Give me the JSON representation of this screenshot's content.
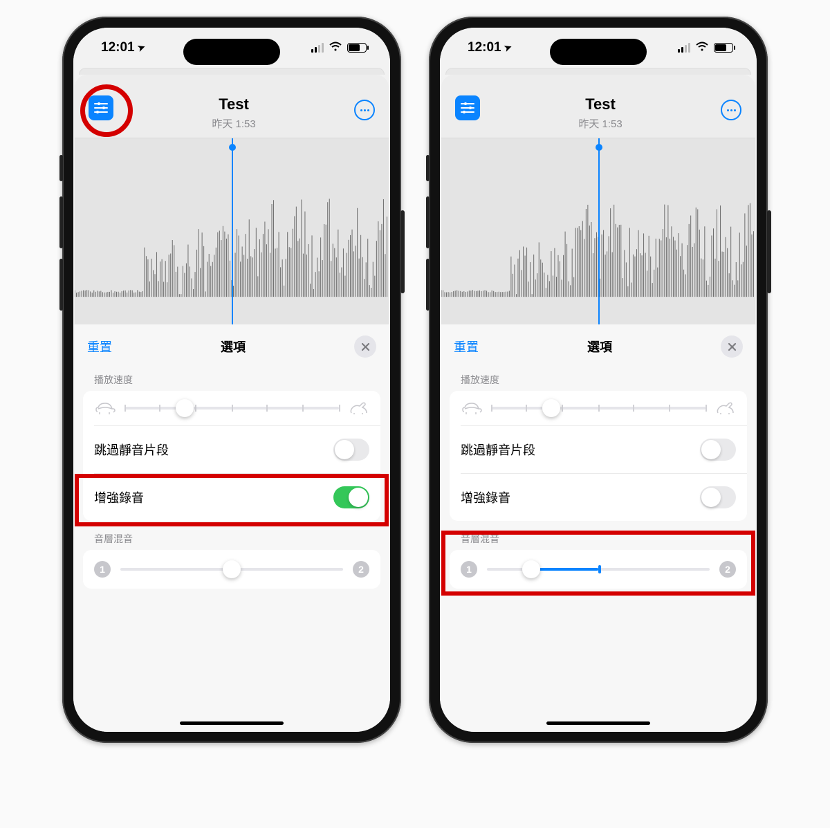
{
  "status": {
    "time": "12:01",
    "location_arrow": "➤"
  },
  "memo": {
    "title": "Test",
    "subtitle": "昨天  1:53"
  },
  "sheet": {
    "reset": "重置",
    "title": "選項",
    "speed_label": "播放速度",
    "skip_silence": "跳過靜音片段",
    "enhance_recording": "增強錄音",
    "layer_mix": "音層混音",
    "mix_badge_1": "1",
    "mix_badge_2": "2"
  },
  "phones": [
    {
      "id": "left",
      "show_options_circle": true,
      "enhance_on": true,
      "red_box_target": "enhance",
      "speed_pos": 0.28,
      "mix_pos": 0.5,
      "mix_fill_from": 0.5,
      "mix_fill_to": 0.5
    },
    {
      "id": "right",
      "show_options_circle": false,
      "enhance_on": false,
      "red_box_target": "layermix",
      "speed_pos": 0.28,
      "mix_pos": 0.2,
      "mix_fill_from": 0.2,
      "mix_fill_to": 0.5
    }
  ]
}
